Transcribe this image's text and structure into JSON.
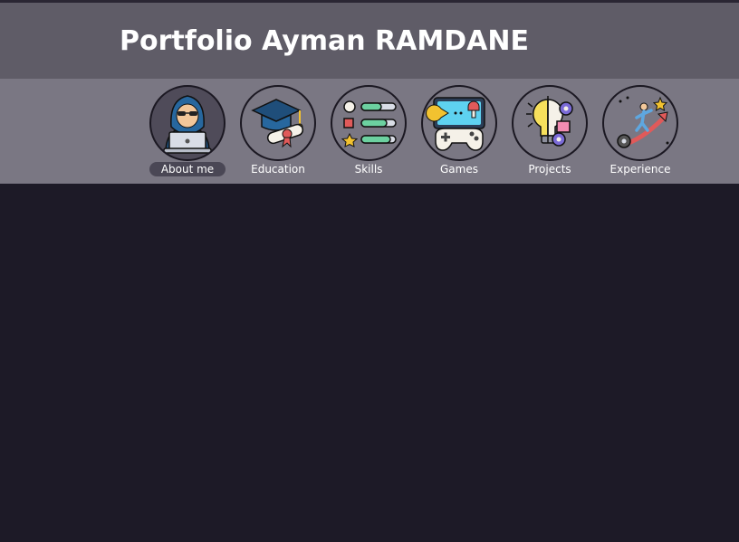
{
  "header": {
    "title": "Portfolio Ayman RAMDANE"
  },
  "nav": {
    "items": [
      {
        "label": "About me",
        "icon": "hacker-laptop-icon",
        "active": true
      },
      {
        "label": "Education",
        "icon": "graduation-cap-diploma-icon",
        "active": false
      },
      {
        "label": "Skills",
        "icon": "skills-bars-icon",
        "active": false
      },
      {
        "label": "Games",
        "icon": "gamepad-screen-icon",
        "active": false
      },
      {
        "label": "Projects",
        "icon": "lightbulb-gears-icon",
        "active": false
      },
      {
        "label": "Experience",
        "icon": "climbing-growth-icon",
        "active": false
      }
    ]
  },
  "colors": {
    "background": "#1d1a27",
    "header": "#5f5c67",
    "nav": "#7a7783",
    "active_label": "#4a4755"
  }
}
